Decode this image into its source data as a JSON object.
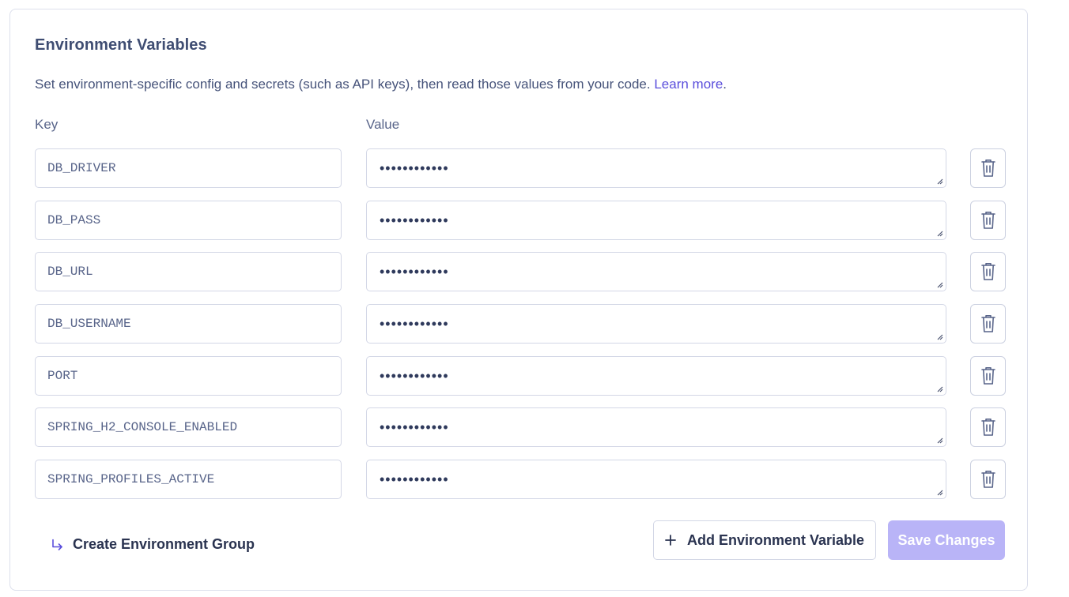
{
  "section": {
    "title": "Environment Variables",
    "description": "Set environment-specific config and secrets (such as API keys), then read those values from your code.",
    "learn_more_label": "Learn more",
    "period": "."
  },
  "columns": {
    "key_label": "Key",
    "value_label": "Value"
  },
  "variables": [
    {
      "key": "DB_DRIVER",
      "value_masked": "••••••••••••"
    },
    {
      "key": "DB_PASS",
      "value_masked": "••••••••••••"
    },
    {
      "key": "DB_URL",
      "value_masked": "••••••••••••"
    },
    {
      "key": "DB_USERNAME",
      "value_masked": "••••••••••••"
    },
    {
      "key": "PORT",
      "value_masked": "••••••••••••"
    },
    {
      "key": "SPRING_H2_CONSOLE_ENABLED",
      "value_masked": "••••••••••••"
    },
    {
      "key": "SPRING_PROFILES_ACTIVE",
      "value_masked": "••••••••••••"
    }
  ],
  "actions": {
    "create_group_label": "Create Environment Group",
    "add_variable_label": "Add Environment Variable",
    "save_label": "Save Changes"
  },
  "icons": {
    "delete": "trash-icon",
    "create_group": "arrow-turn-down-right-icon",
    "add": "plus-icon"
  },
  "colors": {
    "link": "#5b4fdc",
    "save_button_disabled": "#b9b4f7",
    "border": "#d3d7e6"
  }
}
